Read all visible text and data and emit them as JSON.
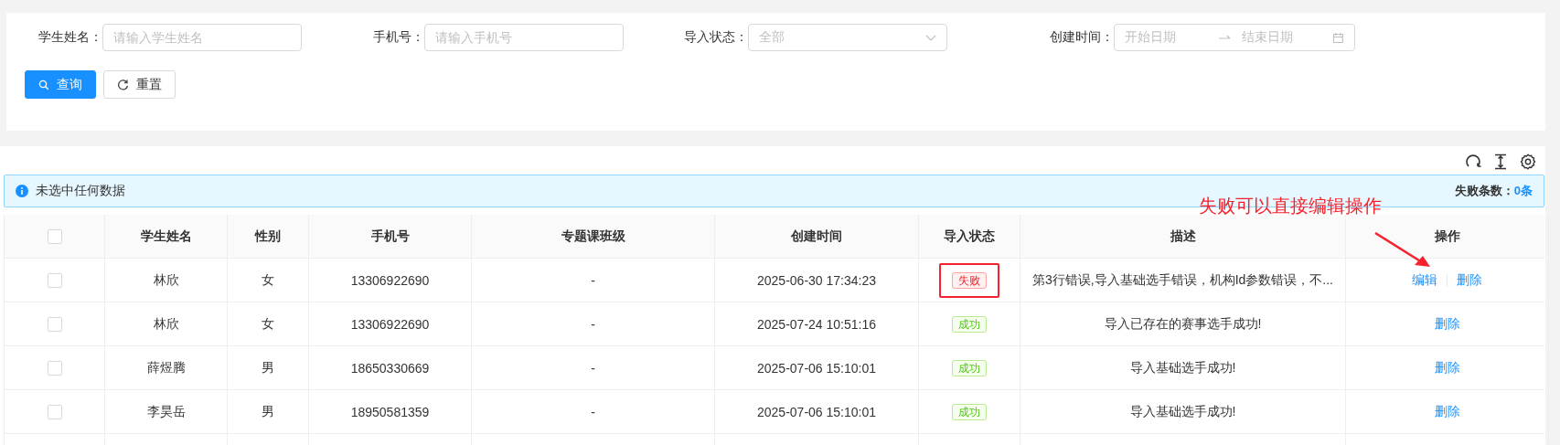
{
  "filters": [
    {
      "label": "学生姓名：",
      "kind": "input",
      "placeholder": "请输入学生姓名"
    },
    {
      "label": "手机号：",
      "kind": "input",
      "placeholder": "请输入手机号"
    },
    {
      "label": "导入状态：",
      "kind": "select",
      "placeholder": "全部"
    },
    {
      "label": "创建时间：",
      "kind": "daterange",
      "start_placeholder": "开始日期",
      "end_placeholder": "结束日期"
    }
  ],
  "buttons": [
    {
      "label": "查询",
      "kind": "primary"
    },
    {
      "label": "重置",
      "kind": "default"
    }
  ],
  "alert": {
    "message": "未选中任何数据",
    "count_label": "失败条数：",
    "count": "0条"
  },
  "table": {
    "select_all": {
      "checked": false
    },
    "columns": [
      "学生姓名",
      "性别",
      "手机号",
      "专题课班级",
      "创建时间",
      "导入状态",
      "描述",
      "操作"
    ],
    "rows": [
      {
        "checked": false,
        "name": "林欣",
        "gender": "女",
        "phone": "13306922690",
        "class": "-",
        "created": "2025-06-30 17:34:23",
        "status": {
          "label": "失败",
          "kind": "error"
        },
        "highlighted": true,
        "description": "第3行错误,导入基础选手错误，机构Id参数错误，不...",
        "actions": [
          "编辑",
          "删除"
        ]
      },
      {
        "checked": false,
        "name": "林欣",
        "gender": "女",
        "phone": "13306922690",
        "class": "-",
        "created": "2025-07-24 10:51:16",
        "status": {
          "label": "成功",
          "kind": "success"
        },
        "highlighted": false,
        "description": "导入已存在的赛事选手成功!",
        "actions": [
          "删除"
        ]
      },
      {
        "checked": false,
        "name": "薛煜腾",
        "gender": "男",
        "phone": "18650330669",
        "class": "-",
        "created": "2025-07-06 15:10:01",
        "status": {
          "label": "成功",
          "kind": "success"
        },
        "highlighted": false,
        "description": "导入基础选手成功!",
        "actions": [
          "删除"
        ]
      },
      {
        "checked": false,
        "name": "李昊岳",
        "gender": "男",
        "phone": "18950581359",
        "class": "-",
        "created": "2025-07-06 15:10:01",
        "status": {
          "label": "成功",
          "kind": "success"
        },
        "highlighted": false,
        "description": "导入基础选手成功!",
        "actions": [
          "删除"
        ]
      }
    ]
  },
  "annotation": {
    "text": "失败可以直接编辑操作"
  }
}
